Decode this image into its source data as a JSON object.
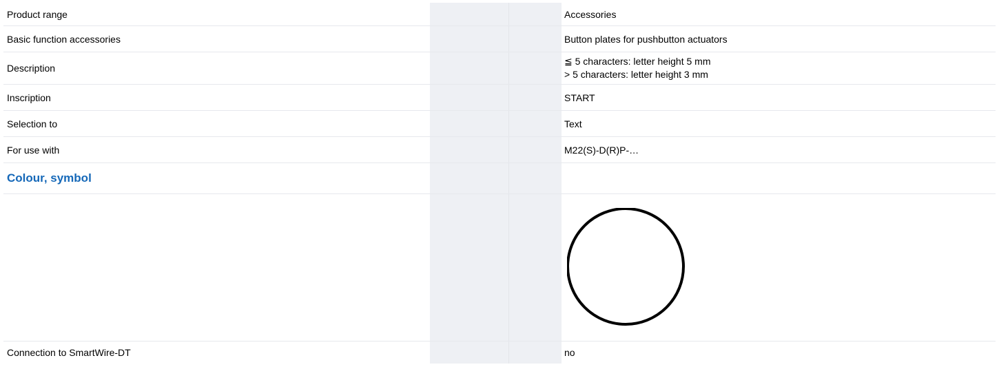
{
  "rows": {
    "product_range": {
      "label": "Product range",
      "value": "Accessories"
    },
    "basic_function": {
      "label": "Basic function accessories",
      "value": "Button plates for pushbutton actuators"
    },
    "description": {
      "label": "Description",
      "value_line1": "≦ 5 characters: letter height 5 mm",
      "value_line2": "> 5 characters: letter height 3 mm"
    },
    "inscription": {
      "label": "Inscription",
      "value": "START"
    },
    "selection_to": {
      "label": "Selection to",
      "value": "Text"
    },
    "for_use_with": {
      "label": "For use with",
      "value": "M22(S)-D(R)P-…"
    },
    "colour_symbol": {
      "heading": "Colour, symbol",
      "symbol_icon": "circle-outline-icon"
    },
    "smartwire": {
      "label": "Connection to SmartWire-DT",
      "value": "no"
    }
  },
  "colors": {
    "heading": "#1568b8",
    "shaded_column": "#eef0f4",
    "row_divider": "#e6e8ed"
  }
}
